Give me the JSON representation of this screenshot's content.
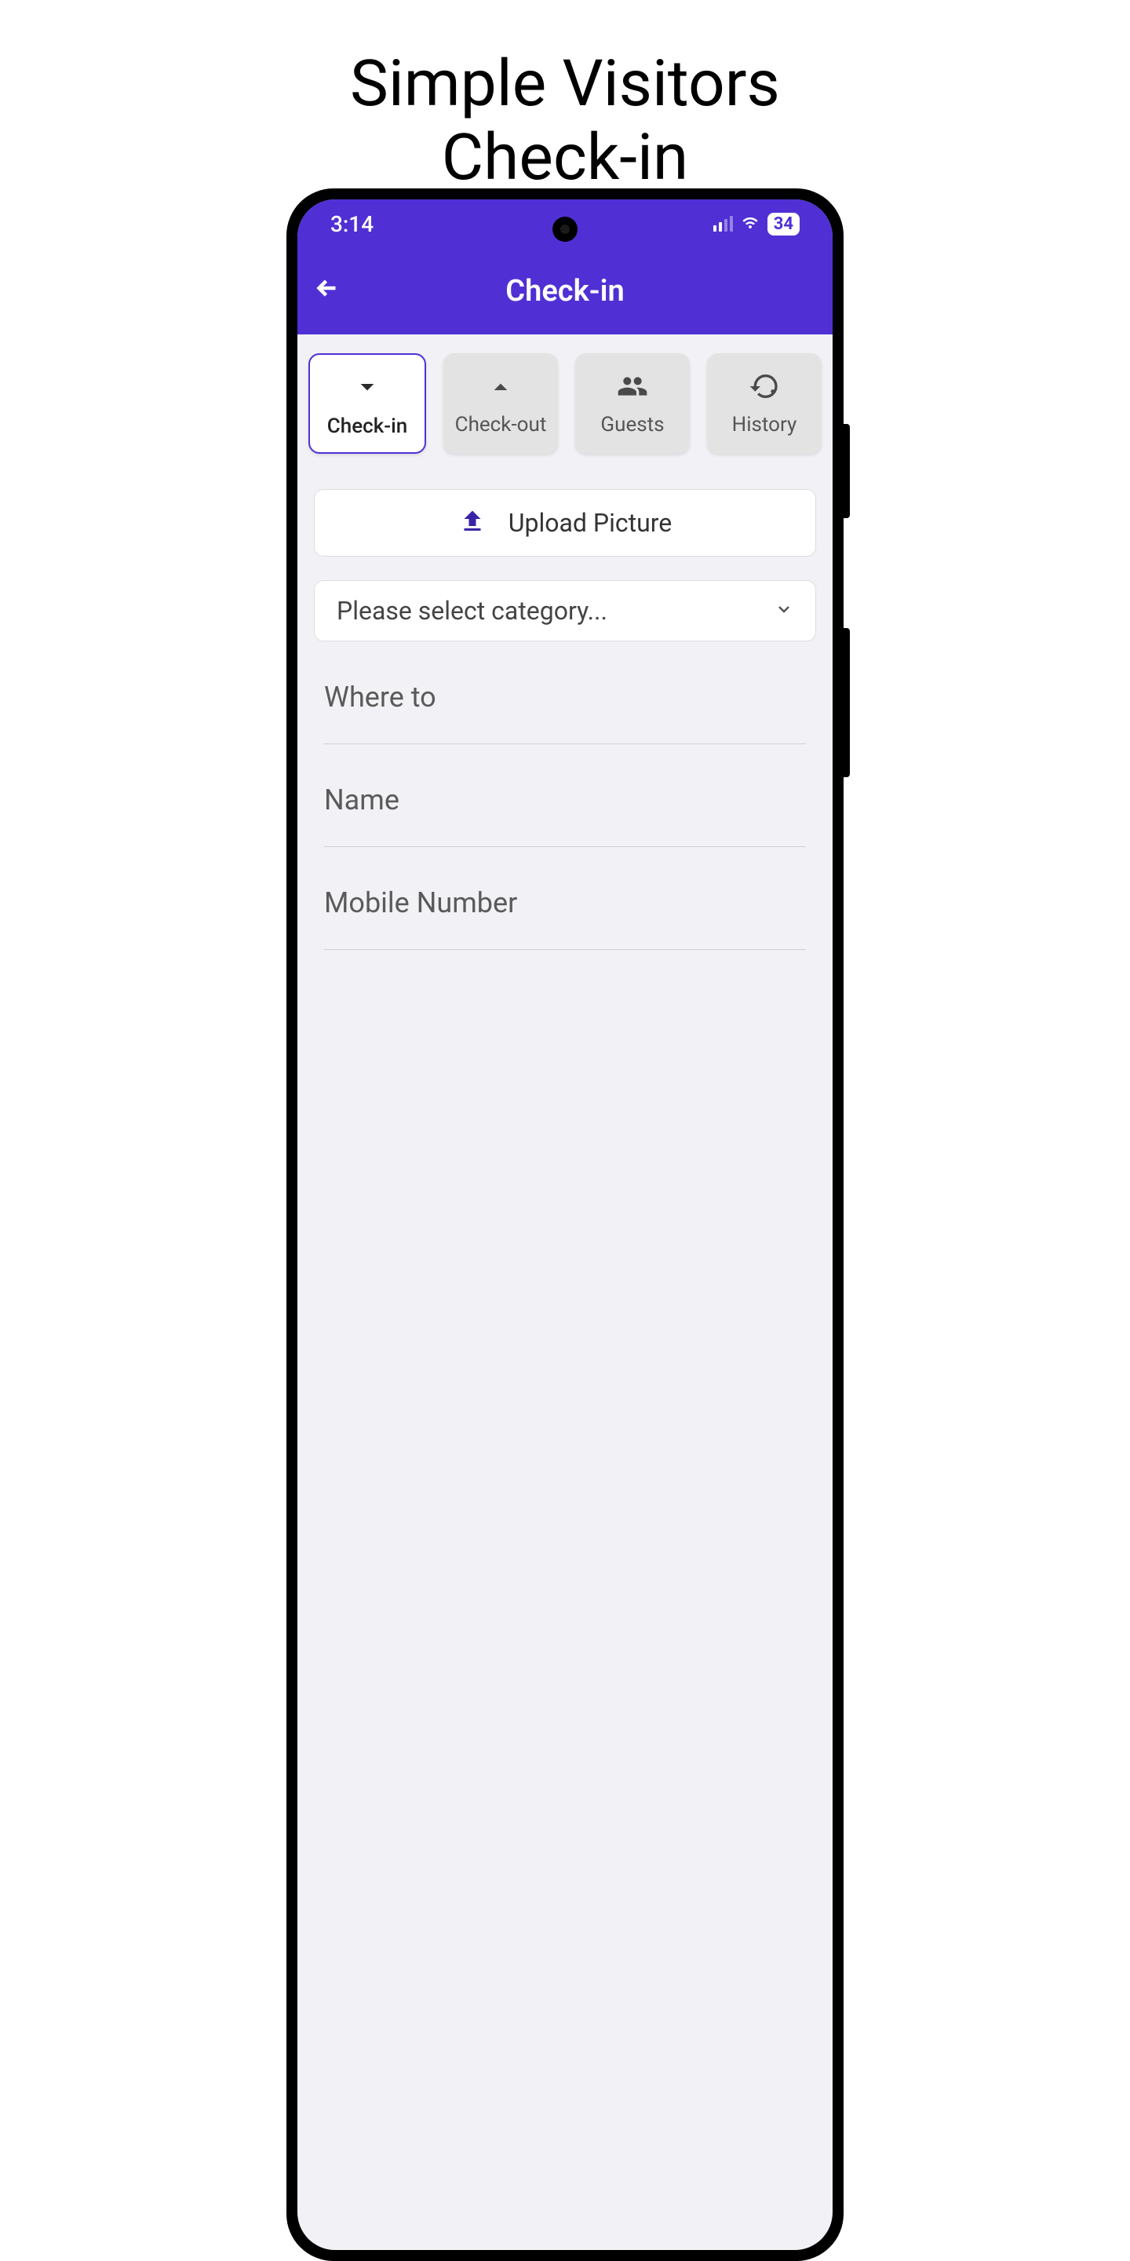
{
  "promo": {
    "title_line1": "Simple Visitors",
    "title_line2": "Check-in"
  },
  "status_bar": {
    "time": "3:14",
    "battery": "34"
  },
  "header": {
    "title": "Check-in"
  },
  "tabs": [
    {
      "label": "Check-in",
      "icon": "chevron-down",
      "active": true
    },
    {
      "label": "Check-out",
      "icon": "chevron-up",
      "active": false
    },
    {
      "label": "Guests",
      "icon": "people",
      "active": false
    },
    {
      "label": "History",
      "icon": "history",
      "active": false
    }
  ],
  "upload": {
    "label": "Upload Picture"
  },
  "category": {
    "placeholder": "Please select category..."
  },
  "fields": [
    {
      "placeholder": "Where to"
    },
    {
      "placeholder": "Name"
    },
    {
      "placeholder": "Mobile Number"
    }
  ]
}
